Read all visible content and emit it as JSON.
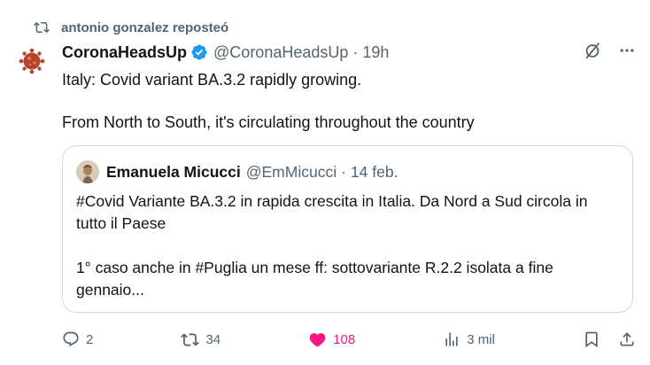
{
  "repost": {
    "text": "antonio gonzalez reposteó"
  },
  "post": {
    "display_name": "CoronaHeadsUp",
    "handle": "@CoronaHeadsUp",
    "separator": "·",
    "time": "19h",
    "text": "Italy: Covid variant BA.3.2 rapidly growing.\n\nFrom North to South, it's circulating throughout the country"
  },
  "quote": {
    "display_name": "Emanuela Micucci",
    "handle": "@EmMicucci",
    "separator": "·",
    "time": "14 feb.",
    "text": "#Covid Variante BA.3.2 in rapida crescita in Italia. Da Nord a Sud circola in tutto il Paese\n\n1° caso anche in #Puglia un mese ff: sottovariante R.2.2 isolata a fine gennaio..."
  },
  "actions": {
    "replies": "2",
    "reposts": "34",
    "likes": "108",
    "views": "3 mil"
  },
  "icons": {
    "repost": "repost-icon",
    "verified": "verified-badge-icon",
    "grok": "grok-icon",
    "more": "more-icon",
    "reply": "reply-icon",
    "like": "heart-icon",
    "views": "views-icon",
    "bookmark": "bookmark-icon",
    "share": "share-icon"
  },
  "colors": {
    "verified": "#1d9bf0",
    "like": "#f91880",
    "muted": "#536471",
    "border": "#cfd9de"
  }
}
